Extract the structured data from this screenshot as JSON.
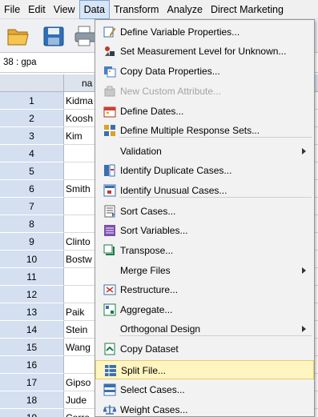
{
  "menubar": [
    "File",
    "Edit",
    "View",
    "Data",
    "Transform",
    "Analyze",
    "Direct Marketing"
  ],
  "cell_ref": "38 : gpa",
  "column_header": "na",
  "rows": [
    {
      "num": "1",
      "val": "Kidma"
    },
    {
      "num": "2",
      "val": "Koosh"
    },
    {
      "num": "3",
      "val": "Kim"
    },
    {
      "num": "4",
      "val": ""
    },
    {
      "num": "5",
      "val": ""
    },
    {
      "num": "6",
      "val": "Smith"
    },
    {
      "num": "7",
      "val": ""
    },
    {
      "num": "8",
      "val": ""
    },
    {
      "num": "9",
      "val": "Clinto"
    },
    {
      "num": "10",
      "val": "Bostw"
    },
    {
      "num": "11",
      "val": ""
    },
    {
      "num": "12",
      "val": ""
    },
    {
      "num": "13",
      "val": "Paik"
    },
    {
      "num": "14",
      "val": "Stein"
    },
    {
      "num": "15",
      "val": "Wang"
    },
    {
      "num": "16",
      "val": ""
    },
    {
      "num": "17",
      "val": "Gipso"
    },
    {
      "num": "18",
      "val": "Jude"
    },
    {
      "num": "19",
      "val": "Corre"
    }
  ],
  "menu": {
    "items": [
      {
        "label": "Define Variable Properties...",
        "icon": "define-variable-properties-icon"
      },
      {
        "label": "Set Measurement Level for Unknown...",
        "icon": "measurement-level-icon"
      },
      {
        "label": "Copy Data Properties...",
        "icon": "copy-data-properties-icon"
      },
      {
        "label": "New Custom Attribute...",
        "icon": "new-custom-attribute-icon"
      },
      {
        "label": "Define Dates...",
        "icon": "calendar-icon"
      },
      {
        "label": "Define Multiple Response Sets...",
        "icon": "multiple-response-icon"
      },
      {
        "label": "Validation",
        "icon": ""
      },
      {
        "label": "Identify Duplicate Cases...",
        "icon": "duplicate-cases-icon"
      },
      {
        "label": "Identify Unusual Cases...",
        "icon": "unusual-cases-icon"
      },
      {
        "label": "Sort Cases...",
        "icon": "sort-cases-icon"
      },
      {
        "label": "Sort Variables...",
        "icon": "sort-variables-icon"
      },
      {
        "label": "Transpose...",
        "icon": "transpose-icon"
      },
      {
        "label": "Merge Files",
        "icon": ""
      },
      {
        "label": "Restructure...",
        "icon": "restructure-icon"
      },
      {
        "label": "Aggregate...",
        "icon": "aggregate-icon"
      },
      {
        "label": "Orthogonal Design",
        "icon": ""
      },
      {
        "label": "Copy Dataset",
        "icon": "copy-dataset-icon"
      },
      {
        "label": "Split File...",
        "icon": "split-file-icon"
      },
      {
        "label": "Select Cases...",
        "icon": "select-cases-icon"
      },
      {
        "label": "Weight Cases...",
        "icon": "weight-cases-icon"
      }
    ],
    "disabled_item": "New Custom Attribute...",
    "highlighted_item": "Split File..."
  },
  "toolbar_icons": [
    "open-folder-icon",
    "save-icon",
    "print-icon"
  ],
  "colors": {
    "menu_highlight": "#fff5c0",
    "menubar_active": "#d7e5f6",
    "row_header": "#d4dff0"
  }
}
